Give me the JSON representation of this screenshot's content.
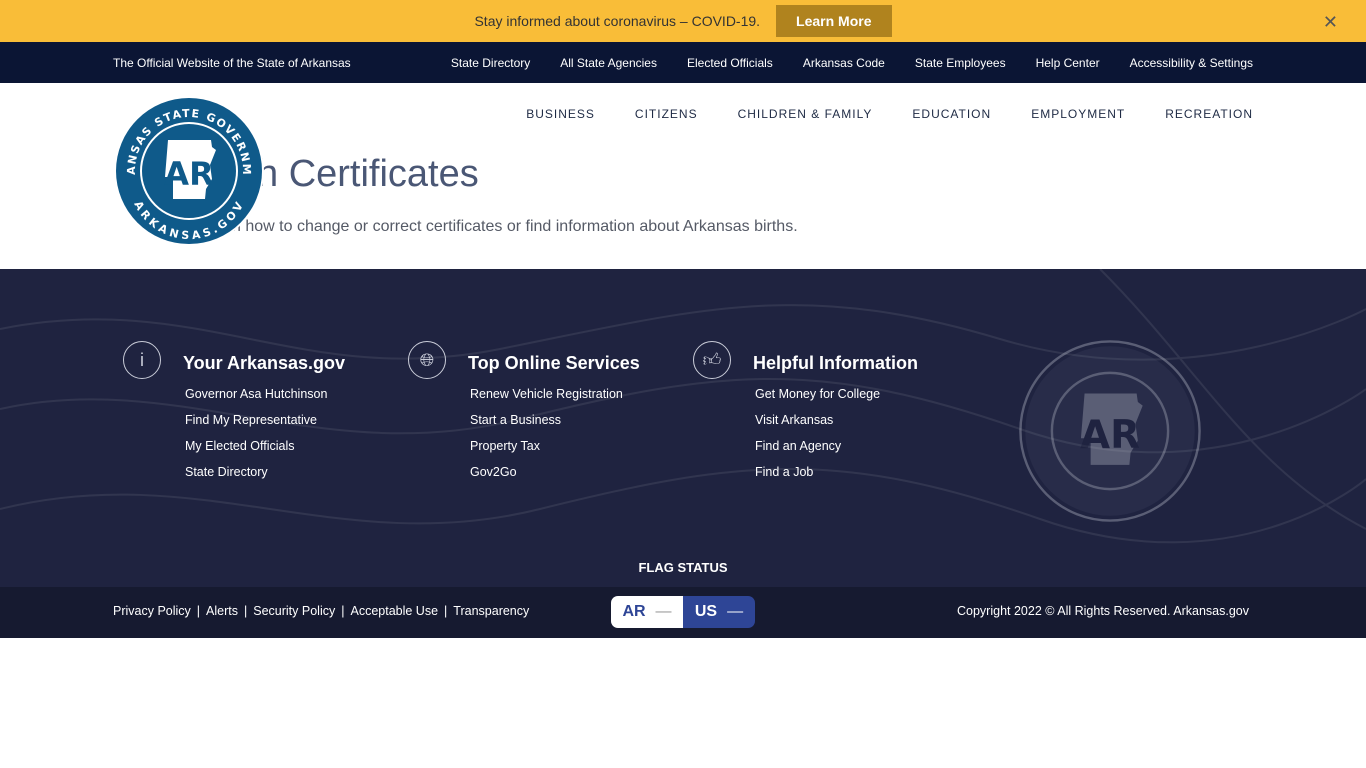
{
  "banner": {
    "text": "Stay informed about coronavirus – COVID-19.",
    "button": "Learn More",
    "close_icon": "close-icon"
  },
  "topbar": {
    "title": "The Official Website of the State of Arkansas",
    "links": [
      "State Directory",
      "All State Agencies",
      "Elected Officials",
      "Arkansas Code",
      "State Employees",
      "Help Center",
      "Accessibility & Settings"
    ]
  },
  "nav": [
    "BUSINESS",
    "CITIZENS",
    "CHILDREN & FAMILY",
    "EDUCATION",
    "EMPLOYMENT",
    "RECREATION"
  ],
  "logo": {
    "top": "ARKANSAS STATE GOVERNMENT",
    "bottom": "ARKANSAS.GOV",
    "mark": "AR"
  },
  "page": {
    "title": "Birth Certificates",
    "subtitle": "Learn how to change or correct certificates or find information about Arkansas births."
  },
  "footer": {
    "columns": [
      {
        "icon": "info-icon",
        "title": "Your Arkansas.gov",
        "links": [
          "Governor Asa Hutchinson",
          "Find My Representative",
          "My Elected Officials",
          "State Directory"
        ]
      },
      {
        "icon": "globe-icon",
        "title": "Top Online Services",
        "links": [
          "Renew Vehicle Registration",
          "Start a Business",
          "Property Tax",
          "Gov2Go"
        ]
      },
      {
        "icon": "thumbs-up-icon",
        "title": "Helpful Information",
        "links": [
          "Get Money for College",
          "Visit Arkansas",
          "Find an Agency",
          "Find a Job"
        ]
      }
    ],
    "flag_status": "FLAG STATUS",
    "flag": {
      "ar": "AR",
      "us": "US",
      "ar_state": "—",
      "us_state": "—"
    },
    "legal": [
      "Privacy Policy",
      "Alerts",
      "Security Policy",
      "Acceptable Use",
      "Transparency"
    ],
    "copyright": "Copyright 2022 © All Rights Reserved. Arkansas.gov"
  }
}
